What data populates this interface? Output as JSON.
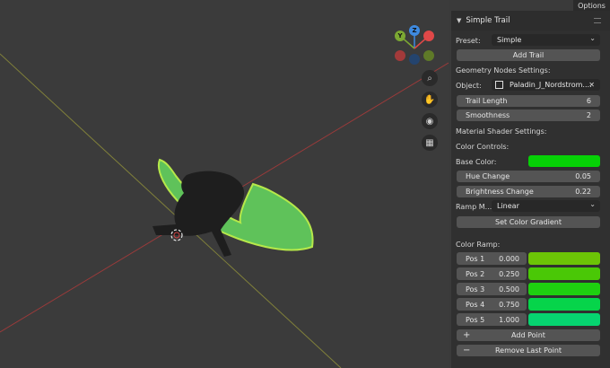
{
  "viewport": {
    "tools": [
      "zoom-icon",
      "hand-icon",
      "camera-icon",
      "grid-icon"
    ],
    "gizmo": {
      "x": "",
      "y": "Y",
      "z": "Z",
      "x_color": "#e04848",
      "y_color": "#7ca832",
      "z_color": "#3e8ae0"
    }
  },
  "header": {
    "options": "Options"
  },
  "panel": {
    "title": "Simple Trail",
    "preset_label": "Preset:",
    "preset_value": "Simple",
    "add_trail": "Add Trail",
    "geo_header": "Geometry Nodes Settings:",
    "object_label": "Object:",
    "object_value": "Paladin_J_Nordstrom....",
    "trail_length_label": "Trail Length",
    "trail_length_value": "6",
    "smoothness_label": "Smoothness",
    "smoothness_value": "2",
    "material_header": "Material Shader Settings:",
    "color_controls": "Color Controls:",
    "base_color_label": "Base Color:",
    "base_color": "#06d006",
    "hue_label": "Hue Change",
    "hue_value": "0.05",
    "brightness_label": "Brightness Change",
    "brightness_value": "0.22",
    "ramp_mode_label": "Ramp M...",
    "ramp_mode_value": "Linear",
    "set_gradient": "Set Color Gradient",
    "color_ramp_header": "Color Ramp:",
    "ramp": [
      {
        "label": "Pos 1",
        "value": "0.000",
        "color": "#6cc406"
      },
      {
        "label": "Pos 2",
        "value": "0.250",
        "color": "#4ac806"
      },
      {
        "label": "Pos 3",
        "value": "0.500",
        "color": "#1ed010"
      },
      {
        "label": "Pos 4",
        "value": "0.750",
        "color": "#06d44a"
      },
      {
        "label": "Pos 5",
        "value": "1.000",
        "color": "#06d470"
      }
    ],
    "add_point": "Add Point",
    "remove_point": "Remove Last Point"
  }
}
